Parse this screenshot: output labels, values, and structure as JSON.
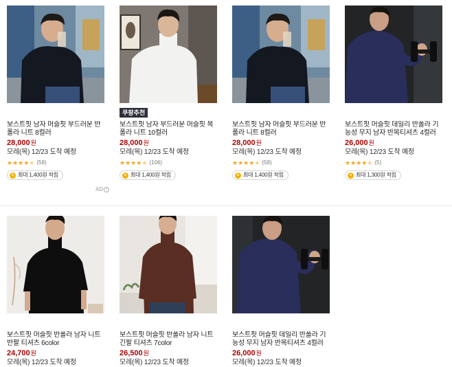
{
  "products": [
    {
      "name": "보스트핏 남자 머슬핏 부드러운 반폴라 니트 8컬러",
      "price": "28,000",
      "currency": "원",
      "delivery": "모레(목) 12/23 도착 예정",
      "rating_stars": 4.5,
      "review_count": "(58)",
      "reward": "최대 1,400원 적립",
      "badge": ""
    },
    {
      "name": "보스트핏 남자 부드러운 머슬핏 목폴라 니트 10컬러",
      "price": "28,000",
      "currency": "원",
      "delivery": "모레(목) 12/23 도착 예정",
      "rating_stars": 4.5,
      "review_count": "(106)",
      "reward": "최대 1,400원 적립",
      "badge": "쿠팡추천"
    },
    {
      "name": "보스트핏 남자 머슬핏 부드러운 반폴라 니트 8컬러",
      "price": "28,000",
      "currency": "원",
      "delivery": "모레(목) 12/23 도착 예정",
      "rating_stars": 4.5,
      "review_count": "(58)",
      "reward": "최대 1,400원 적립",
      "badge": ""
    },
    {
      "name": "보스트핏 머슬핏 데일리 반폴라 기능성 무지 남자 반목티셔츠 4컬러",
      "price": "26,000",
      "currency": "원",
      "delivery": "모레(목) 12/23 도착 예정",
      "rating_stars": 4.5,
      "review_count": "(5)",
      "reward": "최대 1,300원 적립",
      "badge": ""
    },
    {
      "name": "보스트핏 머슬핏 반폴라 남자 니트 반팔 티셔츠 6color",
      "price": "24,700",
      "currency": "원",
      "delivery": "모레(목) 12/23 도착 예정",
      "badge": ""
    },
    {
      "name": "보스트핏 머슬핏 반폴라 남자 니트 긴팔 티셔츠 7color",
      "price": "26,500",
      "currency": "원",
      "delivery": "모레(목) 12/23 도착 예정",
      "badge": ""
    },
    {
      "name": "보스트핏 머슬핏 데일리 반폴라 기능성 무지 남자 반목티셔츠 4컬러",
      "price": "26,000",
      "currency": "원",
      "delivery": "모레(목) 12/23 도착 예정",
      "badge": ""
    }
  ],
  "ad_label": "AD",
  "ad_info_icon": "info-icon",
  "colors": {
    "price": "#ae0000",
    "star": "#f5a623",
    "coin": "#f0b400",
    "badge_bg": "#2d2f3a"
  }
}
